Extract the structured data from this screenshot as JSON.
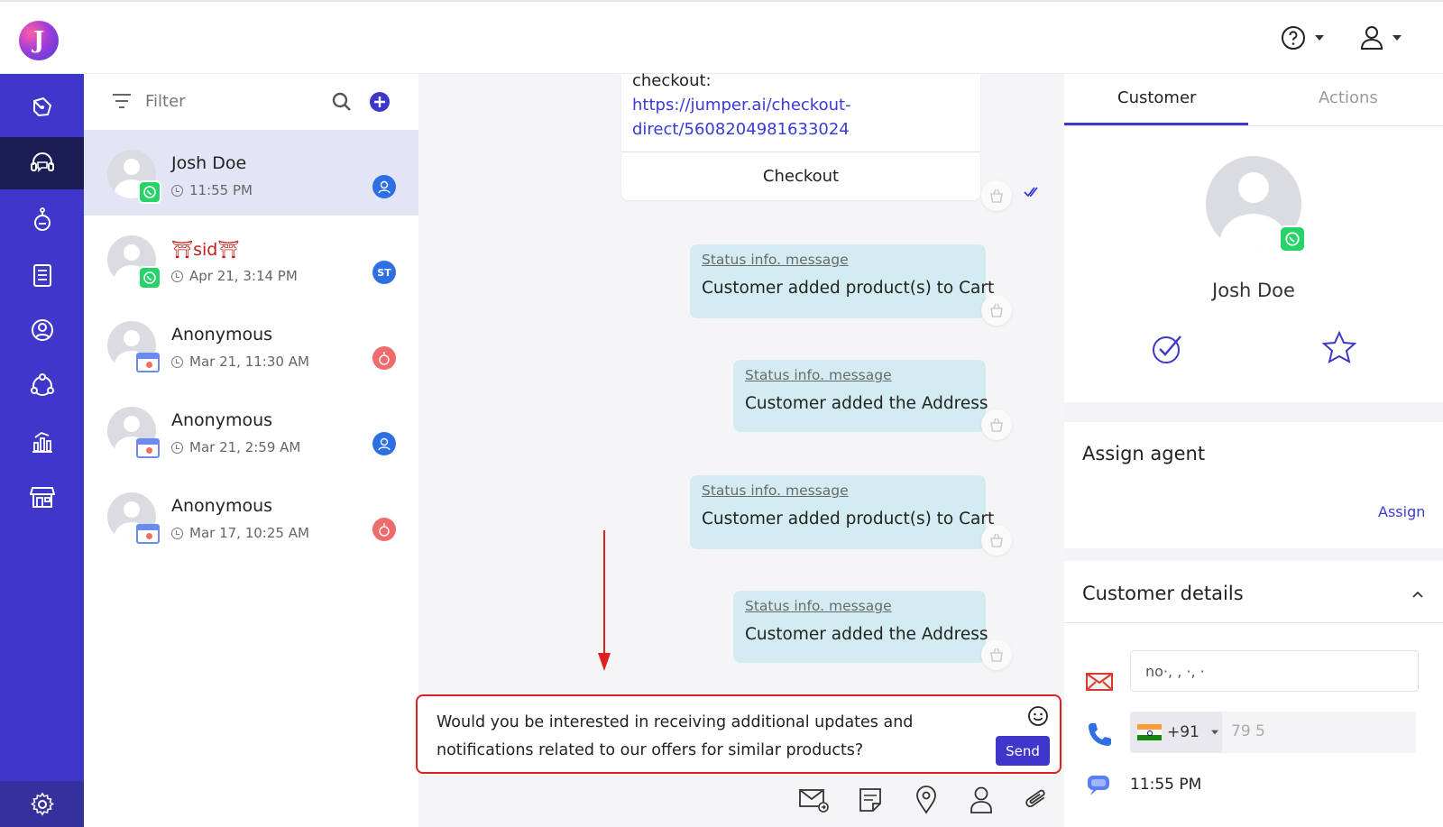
{
  "top": {
    "logo_letter": "J",
    "help_icon": "help-circle-icon",
    "user_icon": "user-icon"
  },
  "rail": {
    "items": [
      {
        "icon": "broadcast-pen-icon"
      },
      {
        "icon": "headset-chat-icon",
        "active": true
      },
      {
        "icon": "bot-icon"
      },
      {
        "icon": "clipboard-list-icon"
      },
      {
        "icon": "contacts-icon"
      },
      {
        "icon": "network-icon"
      },
      {
        "icon": "analytics-icon"
      },
      {
        "icon": "store-icon"
      }
    ],
    "settings_icon": "gear-icon"
  },
  "conv_list": {
    "filter_label": "Filter",
    "conversations": [
      {
        "name": "Josh Doe",
        "time": "11:55 PM",
        "channel": "whatsapp",
        "agent": "user",
        "agent_color": "#2f6fe4",
        "active": true
      },
      {
        "name": "⛩sid⛩",
        "time": "Apr 21, 3:14 PM",
        "channel": "whatsapp",
        "agent": "ST",
        "agent_color": "#2f6fe4"
      },
      {
        "name": "Anonymous",
        "time": "Mar 21, 11:30 AM",
        "channel": "web",
        "agent": "bot",
        "agent_color": "#f06b6b"
      },
      {
        "name": "Anonymous",
        "time": "Mar 21, 2:59 AM",
        "channel": "web",
        "agent": "user",
        "agent_color": "#2f6fe4"
      },
      {
        "name": "Anonymous",
        "time": "Mar 17, 10:25 AM",
        "channel": "web",
        "agent": "bot",
        "agent_color": "#f06b6b"
      }
    ]
  },
  "chat": {
    "card": {
      "text_prefix": "checkout:",
      "link": "https://jumper.ai/checkout-direct/5608204981633024",
      "link_line1": "https://jumper.ai/checkout-",
      "link_line2": "direct/5608204981633024",
      "button": "Checkout"
    },
    "messages": [
      {
        "title": "Status info. message",
        "text": "Customer added product(s) to Cart"
      },
      {
        "title": "Status info. message",
        "text": "Customer added the Address"
      },
      {
        "title": "Status info. message",
        "text": "Customer added product(s) to Cart"
      },
      {
        "title": "Status info. message",
        "text": "Customer added the Address"
      }
    ],
    "composer": {
      "text": "Would you be interested in receiving additional updates and notifications related to our offers for similar products?",
      "send_label": "Send"
    },
    "toolbar": [
      "email-send-icon",
      "template-icon",
      "location-icon",
      "contact-icon",
      "attachment-icon"
    ],
    "annotation_color": "#e02020"
  },
  "right": {
    "tabs": [
      {
        "label": "Customer",
        "active": true
      },
      {
        "label": "Actions",
        "active": false
      }
    ],
    "customer_name": "Josh Doe",
    "assign": {
      "title": "Assign agent",
      "link": "Assign"
    },
    "details": {
      "title": "Customer details",
      "email_value": "no·,    ,  ·,    ·",
      "phone_code": "+91",
      "phone_value": "79                    5",
      "last_seen": "11:55 PM"
    }
  },
  "colors": {
    "brand": "#3f37c9",
    "rail_active": "#1d1d55",
    "bubble": "#d3ecf2",
    "whatsapp": "#25d366",
    "link": "#3a3ad8"
  }
}
